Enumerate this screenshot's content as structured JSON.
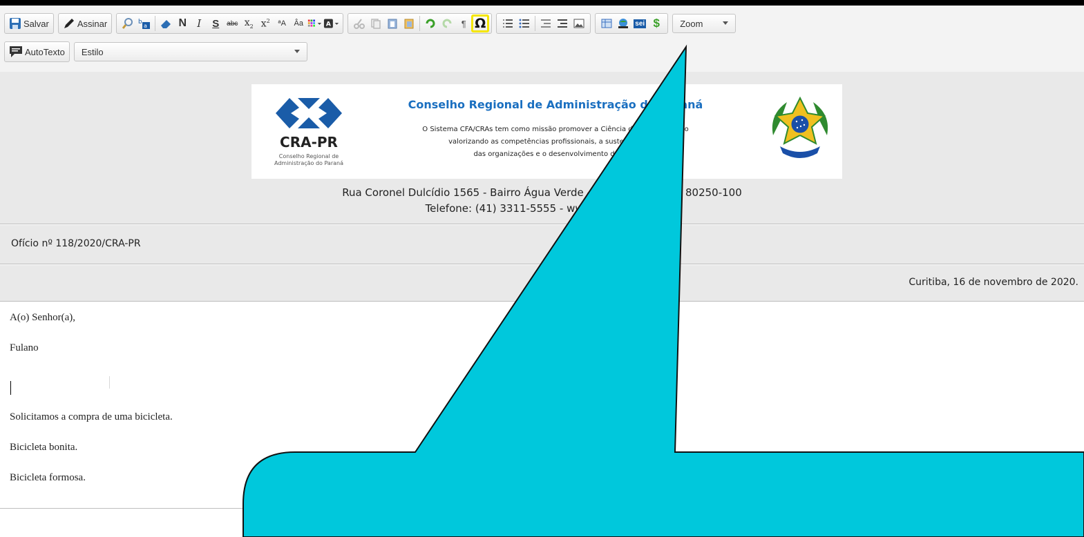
{
  "toolbar": {
    "save_label": "Salvar",
    "sign_label": "Assinar",
    "bold_glyph": "N",
    "italic_glyph": "I",
    "underline_glyph": "S",
    "strike_glyph": "abc",
    "special_char_glyph": "Ω",
    "zoom_label": "Zoom",
    "autotext_label": "AutoTexto",
    "style_label": "Estilo",
    "sei_label": "sei",
    "dollar_glyph": "$",
    "pilcrow_glyph": "¶"
  },
  "letterhead": {
    "org_title": "Conselho Regional de Administração do Paraná",
    "mission_line1": "O Sistema CFA/CRAs tem como missão promover a Ciência da Administração",
    "mission_line2": "valorizando as competências profissionais, a sustentabilidade",
    "mission_line3": "das organizações e o desenvolvimento do país.",
    "logo_text": "CRA-PR",
    "logo_sub1": "Conselho Regional de",
    "logo_sub2": "Administração do Paraná",
    "address_line1": "Rua Coronel Dulcídio 1565 - Bairro Água Verde - Curitiba/PR - CEP 80250-100",
    "address_line2": "Telefone: (41) 3311-5555 - www.cra-pr.org.br"
  },
  "document": {
    "oficio_number": "Ofício nº 118/2020/CRA-PR",
    "date_line": "Curitiba, 16 de novembro de 2020.",
    "salutation": "A(o) Senhor(a),",
    "recipient": "Fulano",
    "paragraph1": "Solicitamos a compra de uma bicicleta.",
    "paragraph2": "Bicicleta bonita.",
    "paragraph3": "Bicicleta formosa."
  },
  "colors": {
    "callout_fill": "#00c8dc",
    "highlight": "#f5e600",
    "logo_blue": "#1a5ca8"
  }
}
